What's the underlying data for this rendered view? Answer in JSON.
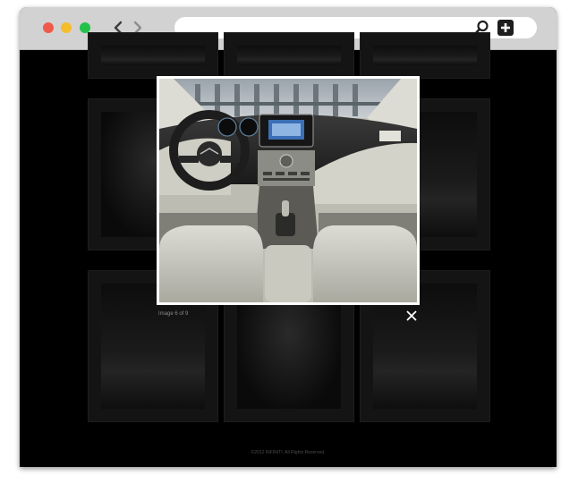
{
  "browser": {
    "traffic_lights": [
      "#ee5a4a",
      "#f5bd2c",
      "#22c24a"
    ],
    "address": ""
  },
  "gallery": {
    "items": [
      {
        "name": "thumb-front-top",
        "kind": "car"
      },
      {
        "name": "thumb-top-middle",
        "kind": "car"
      },
      {
        "name": "thumb-top-right",
        "kind": "car"
      },
      {
        "name": "thumb-seat-interior",
        "kind": "interior"
      },
      {
        "name": "thumb-black-sedan-side",
        "kind": "car"
      },
      {
        "name": "thumb-front-black-sedan",
        "kind": "car"
      },
      {
        "name": "thumb-dashboard",
        "kind": "interior"
      },
      {
        "name": "thumb-rear-sedan-road",
        "kind": "car"
      }
    ]
  },
  "lightbox": {
    "caption": "Image 6 of 9",
    "close_label": "×"
  },
  "footer": {
    "copyright": "©2012 INFINITI. All Rights Reserved."
  }
}
